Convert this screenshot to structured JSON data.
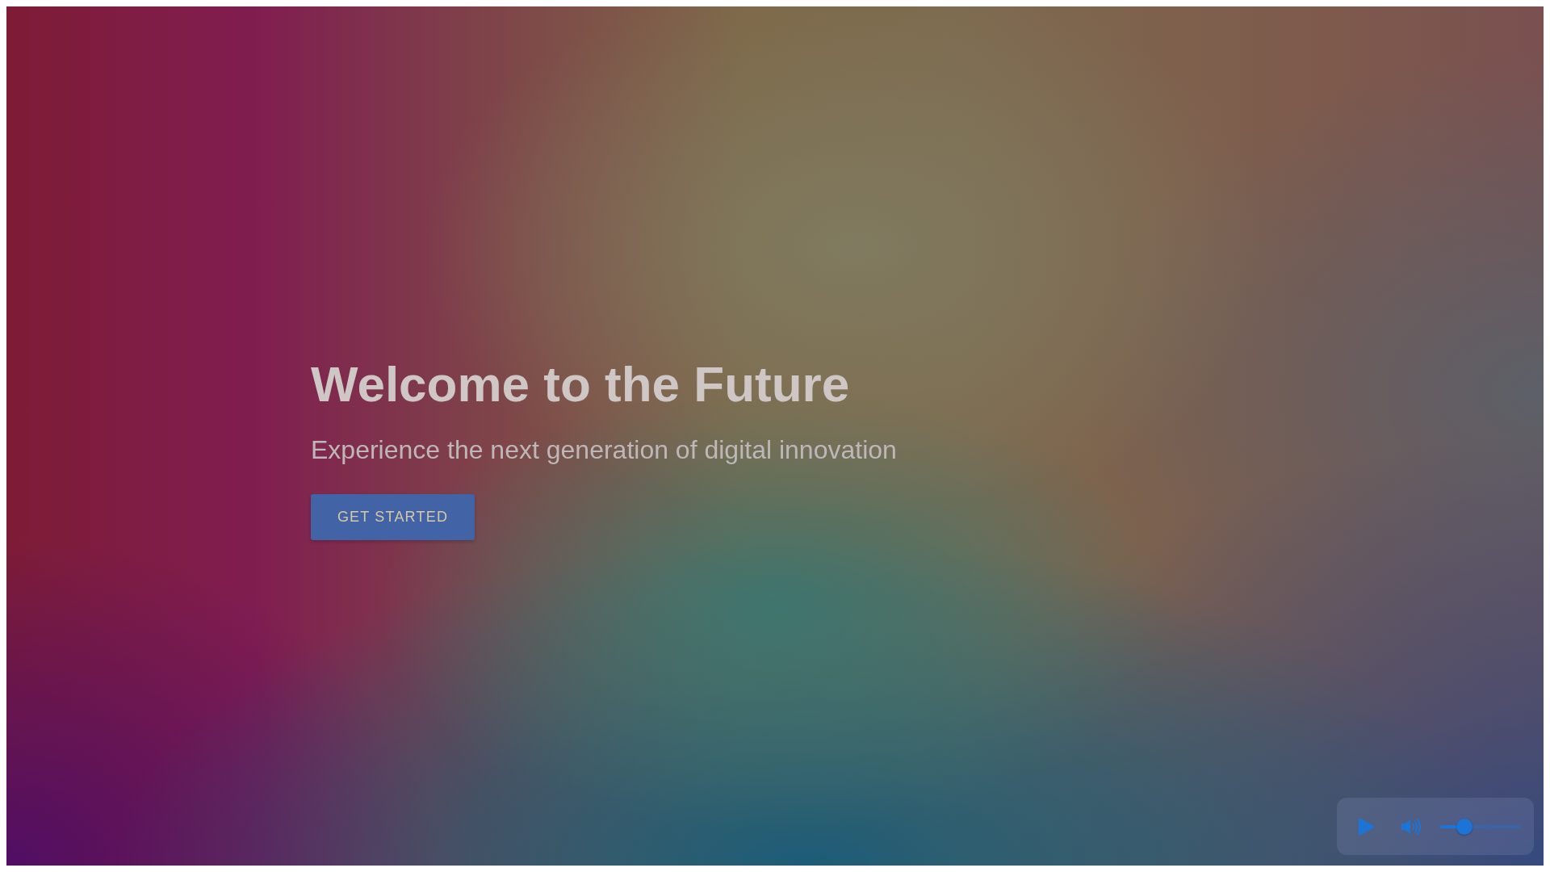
{
  "hero": {
    "title": "Welcome to the Future",
    "subtitle": "Experience the next generation of digital innovation",
    "cta": {
      "label": "GET STARTED"
    }
  },
  "media_controls": {
    "volume": {
      "level": 0.3
    }
  }
}
